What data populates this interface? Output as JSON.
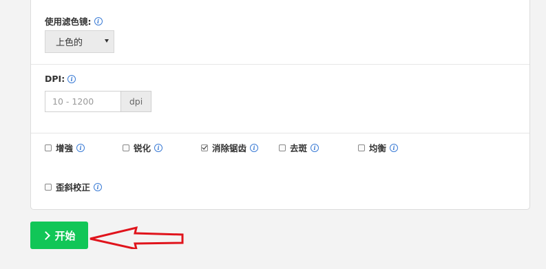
{
  "filter": {
    "label": "使用滤色镜:",
    "selected": "上色的"
  },
  "dpi": {
    "label": "DPI:",
    "placeholder": "10 - 1200",
    "unit": "dpi"
  },
  "options": [
    {
      "label": "增強",
      "checked": false
    },
    {
      "label": "锐化",
      "checked": false
    },
    {
      "label": "消除锯齿",
      "checked": true
    },
    {
      "label": "去斑",
      "checked": false
    },
    {
      "label": "均衡",
      "checked": false
    },
    {
      "label": "歪斜校正",
      "checked": false
    }
  ],
  "start_button": {
    "label": "开始"
  },
  "colors": {
    "button": "#11c657",
    "info_icon": "#3a7bd5",
    "annotation_arrow": "#e0141c"
  },
  "icons": {
    "info": "info-circle-icon",
    "start": "chevron-right-icon",
    "select": "caret-down-icon"
  }
}
